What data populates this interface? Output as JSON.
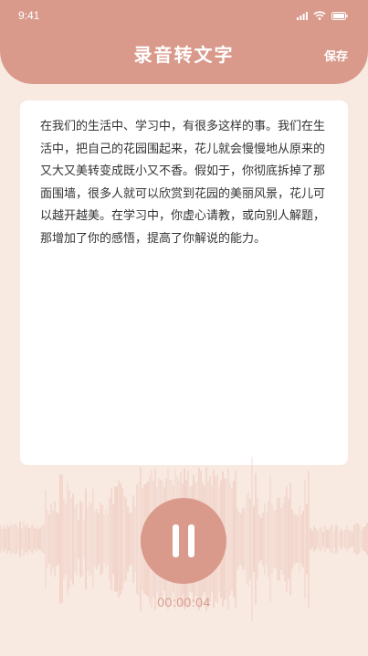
{
  "status_bar": {
    "time": "9:41",
    "icons": [
      "signal-icon",
      "wifi-icon",
      "battery-icon"
    ]
  },
  "header": {
    "title": "录音转文字",
    "save_label": "保存"
  },
  "transcript": {
    "text": "在我们的生活中、学习中，有很多这样的事。我们在生活中，把自己的花园围起来，花儿就会慢慢地从原来的又大又美转变成既小又不香。假如于，你彻底拆掉了那面围墙，很多人就可以欣赏到花园的美丽风景，花儿可以越开越美。在学习中，你虚心请教，或向别人解题，那增加了你的感悟，提高了你解说的能力。"
  },
  "recorder": {
    "state": "recording",
    "button_icon": "pause-icon",
    "elapsed": "00:00:04"
  },
  "colors": {
    "accent": "#d99a8c",
    "background": "#f8e9e1",
    "card": "#ffffff",
    "waveform": "#e8b8ab"
  }
}
